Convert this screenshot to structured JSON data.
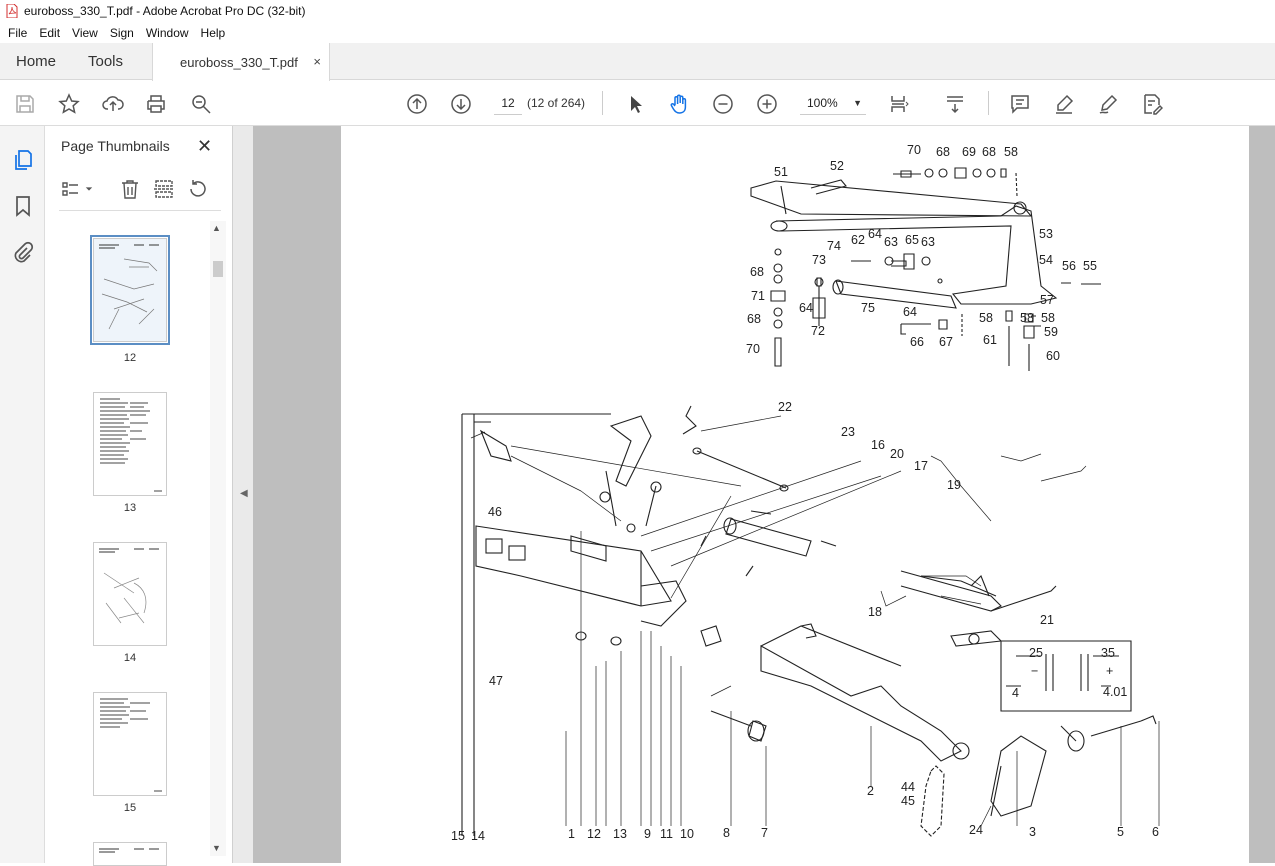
{
  "window": {
    "title": "euroboss_330_T.pdf - Adobe Acrobat Pro DC (32-bit)"
  },
  "menu": [
    "File",
    "Edit",
    "View",
    "Sign",
    "Window",
    "Help"
  ],
  "tabs": {
    "home": "Home",
    "tools": "Tools",
    "document": "euroboss_330_T.pdf",
    "close_glyph": "×"
  },
  "toolbar": {
    "page_number": "12",
    "page_count": "(12 of 264)",
    "zoom": "100%",
    "icons": [
      "save-icon",
      "bookmark-star-icon",
      "upload-icon",
      "print-icon",
      "search-icon",
      "page-up-icon",
      "page-down-icon",
      "select-arrow-icon",
      "hand-icon",
      "zoom-out-icon",
      "zoom-in-icon",
      "page-fit-icon",
      "scroll-mode-icon",
      "comment-icon",
      "highlight-icon",
      "sign-icon",
      "edit-pdf-icon"
    ]
  },
  "sidebar": {
    "title": "Page Thumbnails",
    "close_glyph": "✕",
    "thumbnails": [
      {
        "label": "12",
        "selected": true
      },
      {
        "label": "13",
        "selected": false
      },
      {
        "label": "14",
        "selected": false
      },
      {
        "label": "15",
        "selected": false
      }
    ]
  },
  "diagram": {
    "upper_labels": [
      "70",
      "68",
      "69",
      "68",
      "58",
      "51",
      "52",
      "53",
      "74",
      "62",
      "64",
      "63",
      "65",
      "63",
      "54",
      "56",
      "55",
      "58",
      "68",
      "73",
      "71",
      "64",
      "72",
      "75",
      "57",
      "64",
      "58",
      "58",
      "59",
      "68",
      "66",
      "67",
      "61",
      "60",
      "70"
    ],
    "lower_labels": [
      "22",
      "23",
      "16",
      "20",
      "17",
      "19",
      "46",
      "18",
      "21",
      "47",
      "25",
      "35",
      "−",
      "+",
      "4",
      "4.01",
      "44",
      "45",
      "2",
      "24",
      "3",
      "5",
      "6",
      "15",
      "14",
      "1",
      "12",
      "13",
      "9",
      "11",
      "10",
      "8",
      "7"
    ]
  }
}
